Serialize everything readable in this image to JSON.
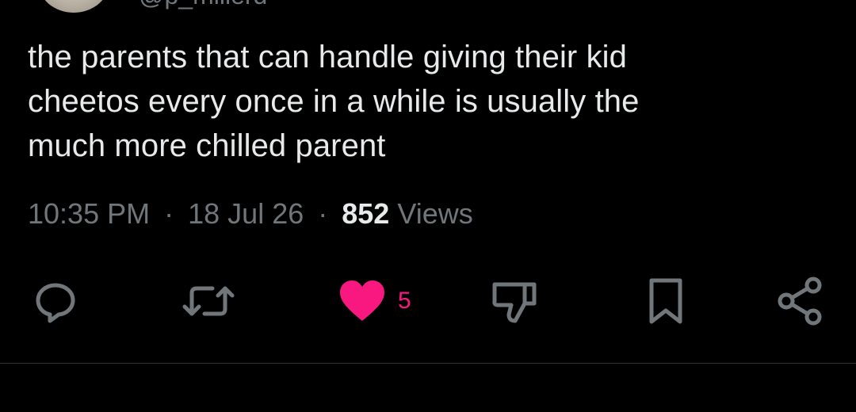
{
  "author": {
    "handle": "@p_millerd"
  },
  "tweet": {
    "lines": [
      "the parents that can handle giving their kid",
      "cheetos every once in a while is usually the",
      "much more chilled parent"
    ]
  },
  "meta": {
    "time": "10:35 PM",
    "separator": "·",
    "date": "18 Jul 26",
    "views_count": "852",
    "views_label": "Views"
  },
  "actions": {
    "reply_icon": "speech-bubble-icon",
    "retweet_icon": "retweet-arrows-icon",
    "like_icon": "heart-filled-icon",
    "like_count": "5",
    "dislike_icon": "thumbs-down-icon",
    "bookmark_icon": "bookmark-icon",
    "share_icon": "share-nodes-icon"
  },
  "colors": {
    "background": "#000000",
    "text_primary": "#e7e9ea",
    "text_secondary": "#71767b",
    "like_active": "#f91880",
    "divider": "#2f3336"
  }
}
